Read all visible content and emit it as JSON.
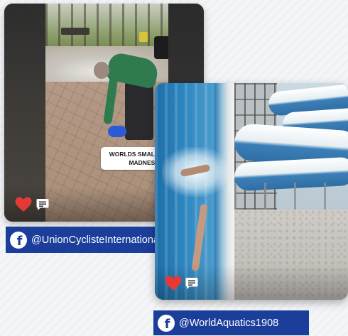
{
  "posts": [
    {
      "caption_line1": "WORLDS SMALLEST BIKE",
      "caption_line2": "MADNESS😁",
      "like_icon": "heart-icon",
      "comment_icon": "comment-icon",
      "handle": "@UnionCyclisteInternationale",
      "network_icon": "facebook-icon"
    },
    {
      "like_icon": "heart-icon",
      "comment_icon": "comment-icon",
      "handle": "@WorldAquatics1908",
      "network_icon": "facebook-icon"
    }
  ],
  "colors": {
    "tag_background": "#1b3e9b",
    "heart": "#e53935",
    "background": "#f4f5f7"
  }
}
